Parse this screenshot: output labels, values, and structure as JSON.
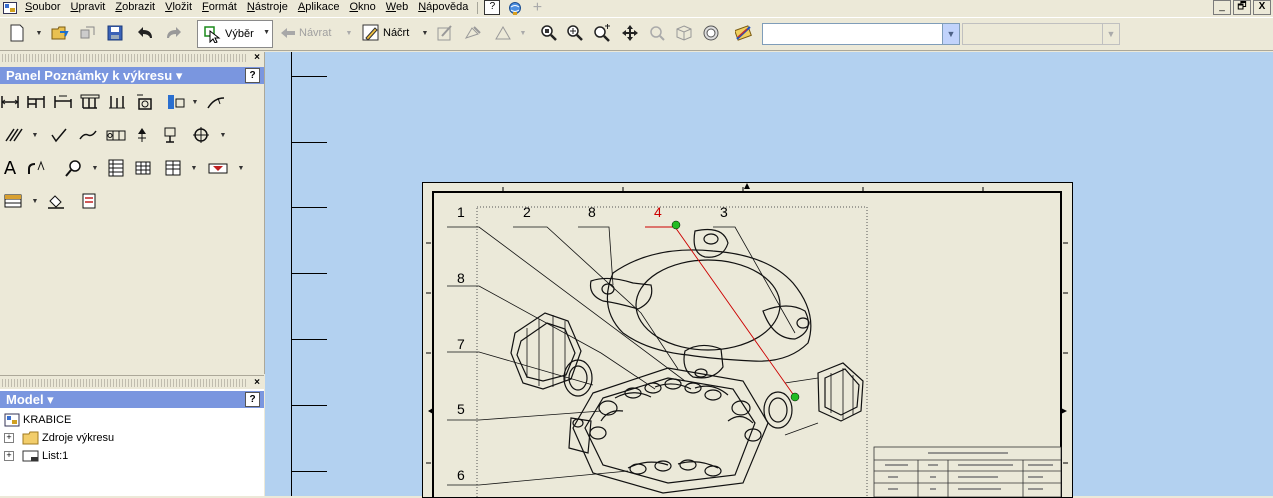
{
  "menu": {
    "items": [
      "Soubor",
      "Upravit",
      "Zobrazit",
      "Vložit",
      "Formát",
      "Nástroje",
      "Aplikace",
      "Okno",
      "Web",
      "Nápověda"
    ],
    "help_glyph": "?"
  },
  "window_buttons": [
    "_",
    "🗗",
    "X"
  ],
  "toolbar": {
    "select_label": "Výběr",
    "back_label": "Návrat",
    "sketch_label": "Náčrt",
    "combo1_value": "",
    "combo2_value": ""
  },
  "panel_notes": {
    "title": "Panel Poznámky k výkresu ▾",
    "help": "?",
    "text_tool_glyph": "A"
  },
  "panel_model": {
    "title": "Model ▾",
    "help": "?",
    "tree": [
      {
        "label": "KRABICE",
        "expander": ""
      },
      {
        "label": "Zdroje výkresu",
        "expander": "+"
      },
      {
        "label": "List:1",
        "expander": "+"
      }
    ]
  },
  "drawing": {
    "balloons": [
      {
        "text": "1",
        "color": "#000000"
      },
      {
        "text": "2",
        "color": "#000000"
      },
      {
        "text": "8",
        "color": "#000000"
      },
      {
        "text": "4",
        "color": "#cc0000"
      },
      {
        "text": "3",
        "color": "#000000"
      },
      {
        "text": "8",
        "color": "#000000"
      },
      {
        "text": "7",
        "color": "#000000"
      },
      {
        "text": "5",
        "color": "#000000"
      },
      {
        "text": "6",
        "color": "#000000"
      }
    ]
  },
  "colors": {
    "canvas": "#b3d1f0",
    "sheet": "#ebe9d9",
    "panel_header": "#7a96df",
    "ui_face": "#ece9d8",
    "highlight": "#cc0000",
    "grip_point": "#22bb22"
  }
}
